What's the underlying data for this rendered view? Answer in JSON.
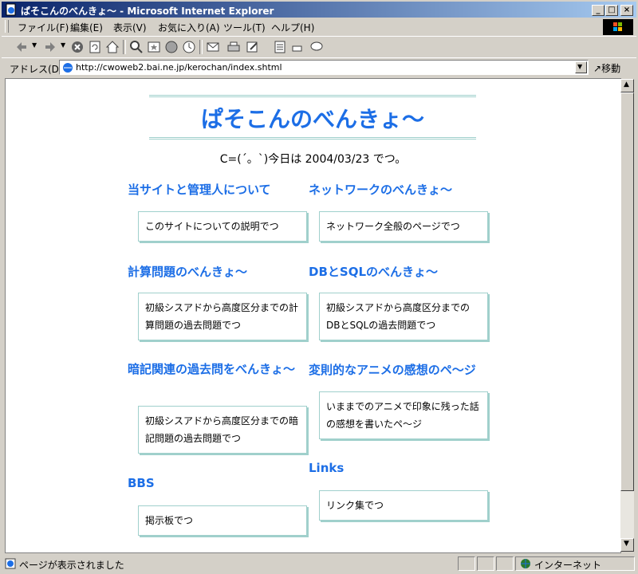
{
  "window": {
    "title": "ぱそこんのべんきょ～ - Microsoft Internet Explorer"
  },
  "menu": {
    "items": [
      "ファイル(F)",
      "編集(E)",
      "表示(V)",
      "お気に入り(A)",
      "ツール(T)",
      "ヘルプ(H)"
    ]
  },
  "address": {
    "label": "アドレス(D)",
    "url": "http://cwoweb2.bai.ne.jp/kerochan/index.shtml",
    "go": "移動"
  },
  "page": {
    "heading": "ぱそこんのべんきょ～",
    "date_line": "C=(´。`)今日は 2004/03/23 でつ。",
    "sections": [
      {
        "title": "当サイトと管理人について",
        "desc": "このサイトについての説明でつ"
      },
      {
        "title": "ネットワークのべんきょ～",
        "desc": "ネットワーク全般のページでつ"
      },
      {
        "title": "計算問題のべんきょ～",
        "desc": "初級シスアドから高度区分までの計算問題の過去問題でつ"
      },
      {
        "title": "DBとSQLのべんきょ～",
        "desc": "初級シスアドから高度区分までのDBとSQLの過去問題でつ"
      },
      {
        "title": "暗記関連の過去問をべんきょ～",
        "desc": "初級シスアドから高度区分までの暗記問題の過去問題でつ"
      },
      {
        "title": "変則的なアニメの感想のペ～ジ",
        "desc": "いままでのアニメで印象に残った話の感想を書いたペ～ジ"
      },
      {
        "title": "BBS",
        "desc": "掲示板でつ"
      },
      {
        "title": "Links",
        "desc": "リンク集でつ"
      }
    ]
  },
  "status": {
    "text": "ページが表示されました",
    "zone": "インターネット"
  }
}
